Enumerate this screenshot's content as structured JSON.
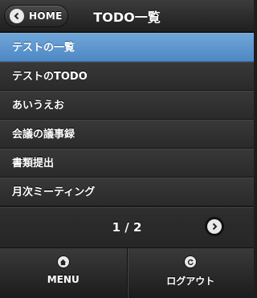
{
  "header": {
    "home_label": "HOME",
    "title": "TODO一覧"
  },
  "list": {
    "items": [
      {
        "label": "テストの一覧",
        "active": true
      },
      {
        "label": "テストのTODO",
        "active": false
      },
      {
        "label": "あいうえお",
        "active": false
      },
      {
        "label": "会議の議事録",
        "active": false
      },
      {
        "label": "書類提出",
        "active": false
      },
      {
        "label": "月次ミーティング",
        "active": false
      }
    ]
  },
  "pager": {
    "text": "1 / 2"
  },
  "footer": {
    "menu_label": "MENU",
    "logout_label": "ログアウト"
  },
  "colors": {
    "accent": "#5b96d0",
    "background": "#2a2a2a"
  },
  "icons": {
    "home": "chevron-left-icon",
    "next": "chevron-right-icon",
    "menu": "home-icon",
    "logout": "refresh-icon"
  }
}
